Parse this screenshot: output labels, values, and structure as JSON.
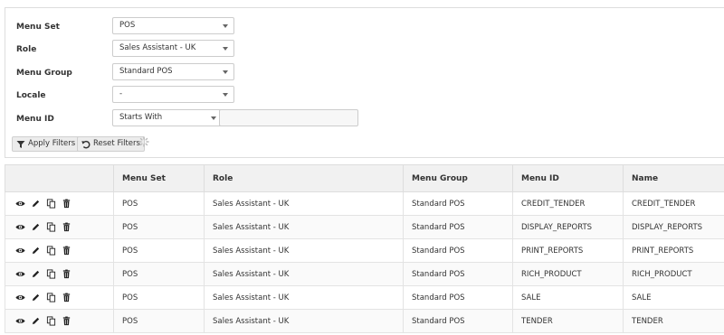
{
  "filters": {
    "menu_set": {
      "label": "Menu Set",
      "value": "POS"
    },
    "role": {
      "label": "Role",
      "value": "Sales Assistant - UK"
    },
    "menu_group": {
      "label": "Menu Group",
      "value": "Standard POS"
    },
    "locale": {
      "label": "Locale",
      "value": "-"
    },
    "menu_id": {
      "label": "Menu ID",
      "operator": "Starts With",
      "value": ""
    },
    "apply_label": "Apply Filters",
    "reset_label": "Reset Filters"
  },
  "table": {
    "columns": [
      "",
      "Menu Set",
      "Role",
      "Menu Group",
      "Menu ID",
      "Name"
    ],
    "rows": [
      {
        "menu_set": "POS",
        "role": "Sales Assistant - UK",
        "menu_group": "Standard POS",
        "menu_id": "CREDIT_TENDER",
        "name": "CREDIT_TENDER"
      },
      {
        "menu_set": "POS",
        "role": "Sales Assistant - UK",
        "menu_group": "Standard POS",
        "menu_id": "DISPLAY_REPORTS",
        "name": "DISPLAY_REPORTS"
      },
      {
        "menu_set": "POS",
        "role": "Sales Assistant - UK",
        "menu_group": "Standard POS",
        "menu_id": "PRINT_REPORTS",
        "name": "PRINT_REPORTS"
      },
      {
        "menu_set": "POS",
        "role": "Sales Assistant - UK",
        "menu_group": "Standard POS",
        "menu_id": "RICH_PRODUCT",
        "name": "RICH_PRODUCT"
      },
      {
        "menu_set": "POS",
        "role": "Sales Assistant - UK",
        "menu_group": "Standard POS",
        "menu_id": "SALE",
        "name": "SALE"
      },
      {
        "menu_set": "POS",
        "role": "Sales Assistant - UK",
        "menu_group": "Standard POS",
        "menu_id": "TENDER",
        "name": "TENDER"
      }
    ],
    "row_actions": [
      "view-icon",
      "edit-icon",
      "copy-icon",
      "delete-icon"
    ]
  }
}
